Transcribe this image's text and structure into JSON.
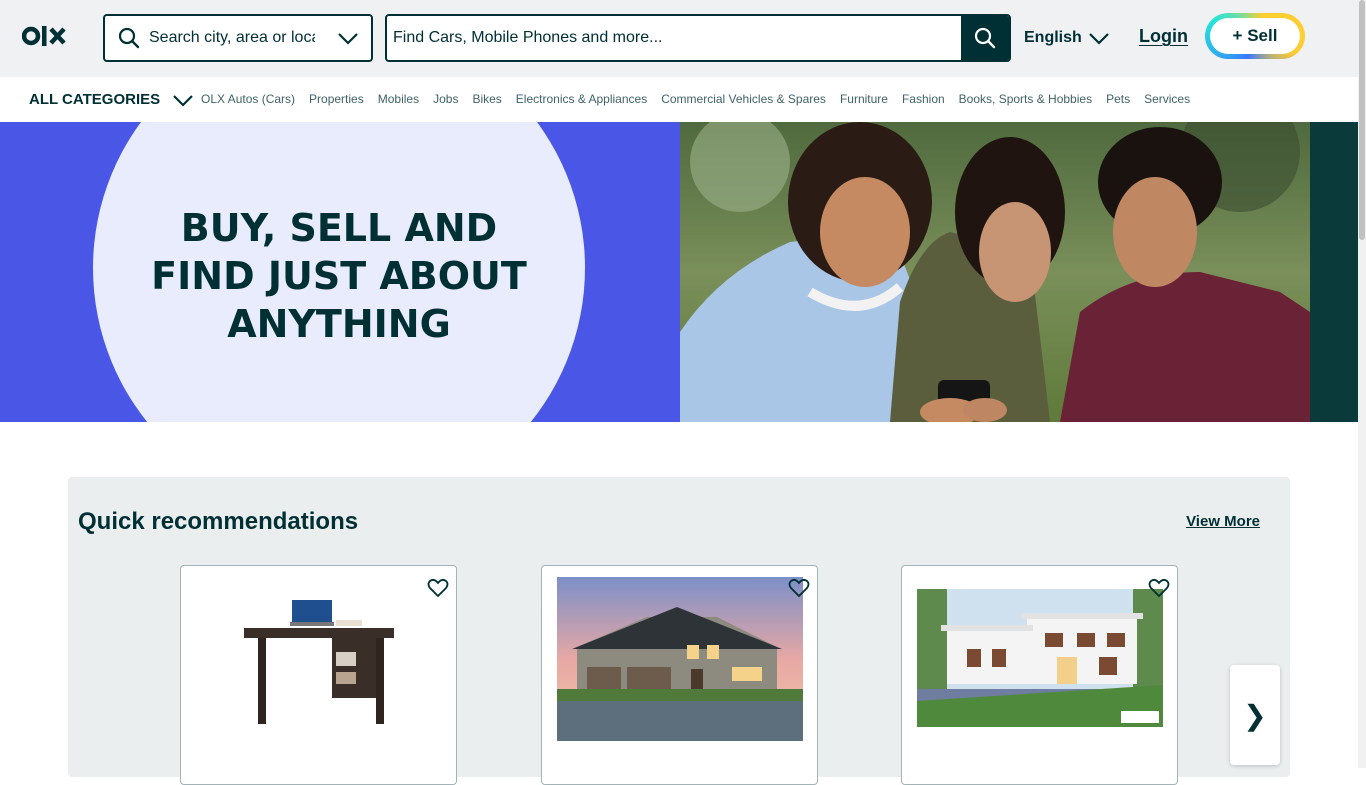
{
  "header": {
    "logo": "OLX",
    "location_placeholder": "Search city, area or locality",
    "search_placeholder": "Find Cars, Mobile Phones and more...",
    "language": "English",
    "login": "Login",
    "sell": "+ Sell"
  },
  "categories": {
    "all_label": "ALL CATEGORIES",
    "items": [
      "OLX Autos (Cars)",
      "Properties",
      "Mobiles",
      "Jobs",
      "Bikes",
      "Electronics & Appliances",
      "Commercial Vehicles & Spares",
      "Furniture",
      "Fashion",
      "Books, Sports & Hobbies",
      "Pets",
      "Services"
    ]
  },
  "banner": {
    "line1": "BUY, SELL AND",
    "line2": "FIND JUST ABOUT",
    "line3": "ANYTHING"
  },
  "recommendations": {
    "title": "Quick recommendations",
    "view_more": "View More",
    "next": "❯"
  },
  "colors": {
    "brand": "#002f34",
    "banner_blue": "#4a57e6",
    "page_bg": "#ebeeef"
  }
}
